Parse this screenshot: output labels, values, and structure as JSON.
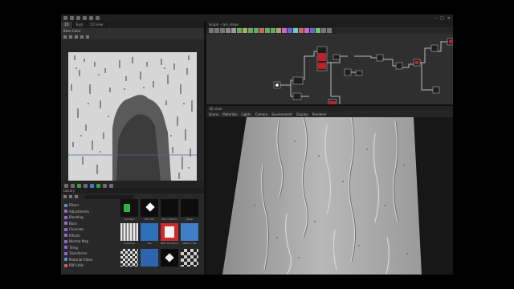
{
  "left_panel": {
    "tabs": [
      {
        "label": "2D"
      },
      {
        "label": "Expl"
      },
      {
        "label": "2D view"
      }
    ],
    "header_label": "Base Color"
  },
  "library": {
    "title": "Library",
    "tree": [
      {
        "label": "Filters",
        "color": "#5c8fd6"
      },
      {
        "label": "Adjustments",
        "color": "#8f6ccf"
      },
      {
        "label": "Blending",
        "color": "#8f6ccf"
      },
      {
        "label": "Blurs",
        "color": "#8f6ccf"
      },
      {
        "label": "Channels",
        "color": "#8f6ccf"
      },
      {
        "label": "Effects",
        "color": "#8f6ccf"
      },
      {
        "label": "Normal Map",
        "color": "#8f6ccf"
      },
      {
        "label": "Tiling",
        "color": "#8f6ccf"
      },
      {
        "label": "Transforms",
        "color": "#8f6ccf"
      },
      {
        "label": "Material Filters",
        "color": "#5c8fd6"
      },
      {
        "label": "PBR Utils",
        "color": "#d65c5c"
      }
    ],
    "thumb_labels": [
      "Gradient",
      "Blur HQ",
      "Non Uniform",
      "Warp",
      "Quantize",
      "Tile",
      "Safe Transform",
      "Make it Tile"
    ]
  },
  "graph": {
    "title": "Graph - rain_drops"
  },
  "view3d": {
    "title": "3D view",
    "menu": [
      "Scene",
      "Materials",
      "Lights",
      "Camera",
      "Environment",
      "Display",
      "Renderer"
    ]
  },
  "colors": {
    "accent_red": "#c0202a",
    "node_bg": "#1e1e1e",
    "wire": "#b9b9b9"
  }
}
